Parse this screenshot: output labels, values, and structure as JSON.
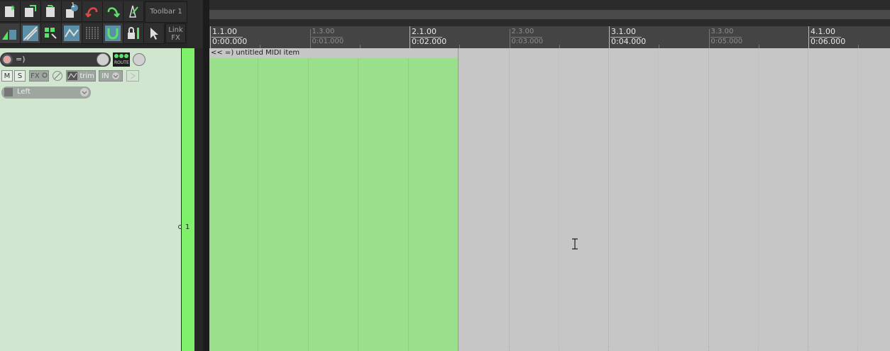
{
  "toolbar": {
    "toolbar_label": "Toolbar 1",
    "link_fx_line1": "Link",
    "link_fx_line2": "FX",
    "badge": "1"
  },
  "track": {
    "name": "=)",
    "route_label": "ROUTE",
    "mute": "M",
    "solo": "S",
    "fx": "FX",
    "trim": "trim",
    "input": "IN",
    "channel": "Left",
    "number": "1"
  },
  "ruler": {
    "markers": [
      {
        "bar": "1.1.00",
        "time": "0:00.000",
        "major": true
      },
      {
        "bar": "1.3.00",
        "time": "0:01.000",
        "major": false
      },
      {
        "bar": "2.1.00",
        "time": "0:02.000",
        "major": true
      },
      {
        "bar": "2.3.00",
        "time": "0:03.000",
        "major": false
      },
      {
        "bar": "3.1.00",
        "time": "0:04.000",
        "major": true
      },
      {
        "bar": "3.3.00",
        "time": "0:05.000",
        "major": false
      },
      {
        "bar": "4.1.00",
        "time": "0:06.000",
        "major": true
      }
    ]
  },
  "item": {
    "title": "<< =) untitled MIDI item"
  },
  "colors": {
    "track_bg": "#d0e6cf",
    "meter": "#7ef06a",
    "item": "#9adf8b",
    "arrange": "#c5c6c5"
  }
}
